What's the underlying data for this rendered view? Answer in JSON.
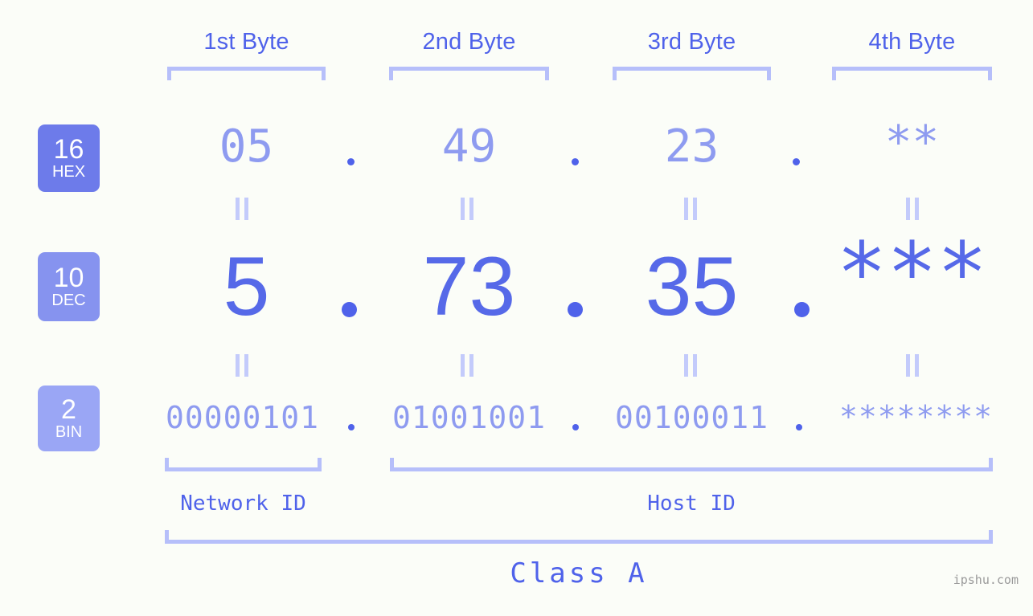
{
  "byte_headers": [
    {
      "label": "1st Byte"
    },
    {
      "label": "2nd Byte"
    },
    {
      "label": "3rd Byte"
    },
    {
      "label": "4th Byte"
    }
  ],
  "radix_badges": [
    {
      "number": "16",
      "word": "HEX",
      "color": "#6d7bea"
    },
    {
      "number": "10",
      "word": "DEC",
      "color": "#8693ef"
    },
    {
      "number": "2",
      "word": "BIN",
      "color": "#9aa6f5"
    }
  ],
  "rows": {
    "hex": {
      "name": "hexadecimal",
      "values": [
        "05",
        "49",
        "23",
        "**"
      ],
      "separator": "."
    },
    "dec": {
      "name": "decimal",
      "values": [
        "5",
        "73",
        "35",
        "***"
      ],
      "separator": "."
    },
    "bin": {
      "name": "binary",
      "values": [
        "00000101",
        "01001001",
        "00100011",
        "********"
      ],
      "separator": "."
    }
  },
  "equals_mark": "||",
  "sections": {
    "network_id": "Network ID",
    "host_id": "Host ID",
    "class": "Class A"
  },
  "watermark": "ipshu.com",
  "colors": {
    "background": "#fbfdf8",
    "accent_strong": "#4f62ea",
    "accent_mid": "#5669e8",
    "accent_light": "#8e9bf0",
    "bracket": "#b6bffa",
    "equals": "#c3cbfb",
    "badge_hex": "#6d7bea",
    "badge_dec": "#8693ef",
    "badge_bin": "#9aa6f5",
    "watermark": "#9a9a9a"
  }
}
